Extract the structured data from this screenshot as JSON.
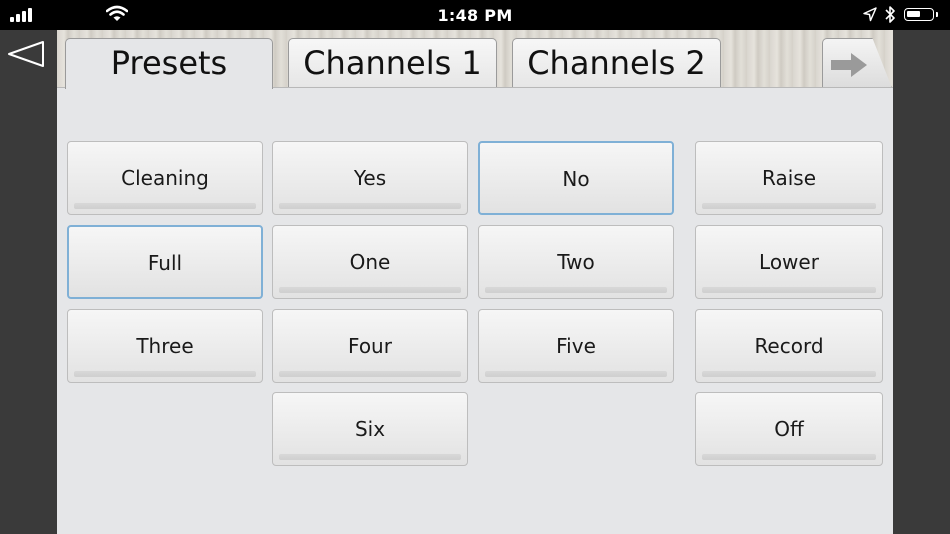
{
  "status_bar": {
    "time": "1:48 PM",
    "icons": [
      "cellular-signal-icon",
      "wifi-icon",
      "location-arrow-icon",
      "bluetooth-icon",
      "battery-icon"
    ]
  },
  "nav": {
    "back_icon": "triangle-back-icon"
  },
  "tabs": [
    {
      "label": "Presets",
      "active": true
    },
    {
      "label": "Channels 1",
      "active": false
    },
    {
      "label": "Channels 2",
      "active": false
    }
  ],
  "next_tab_icon": "arrow-right-icon",
  "buttons": {
    "cleaning": "Cleaning",
    "yes": "Yes",
    "no": "No",
    "raise": "Raise",
    "full": "Full",
    "one": "One",
    "two": "Two",
    "lower": "Lower",
    "three": "Three",
    "four": "Four",
    "five": "Five",
    "record": "Record",
    "six": "Six",
    "off": "Off"
  },
  "selected_buttons": [
    "No",
    "Full"
  ],
  "colors": {
    "selected_border": "#7fb0d6",
    "panel_background": "#e5e6e8",
    "side_background": "#3a3a3a"
  }
}
